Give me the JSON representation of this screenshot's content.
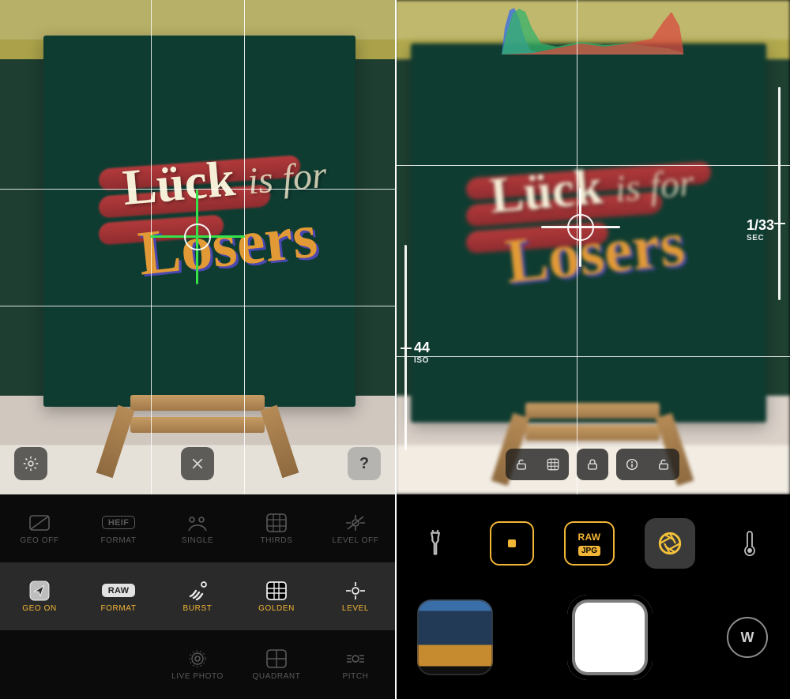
{
  "subject_text": {
    "line1_main": "Lück",
    "line1_rest": "is for",
    "line2": "Losers"
  },
  "left": {
    "overlay": {
      "settings_label": "Settings",
      "close_label": "Close",
      "help_label": "Help"
    },
    "options": {
      "row_dim_top": [
        {
          "id": "geo-off",
          "label": "GEO OFF"
        },
        {
          "id": "format-heif",
          "label": "FORMAT",
          "badge": "HEIF"
        },
        {
          "id": "mode-single",
          "label": "SINGLE"
        },
        {
          "id": "grid-thirds",
          "label": "THIRDS"
        },
        {
          "id": "level-off",
          "label": "LEVEL OFF"
        }
      ],
      "row_active": [
        {
          "id": "geo-on",
          "label": "GEO ON"
        },
        {
          "id": "format-raw",
          "label": "FORMAT",
          "badge": "RAW"
        },
        {
          "id": "mode-burst",
          "label": "BURST"
        },
        {
          "id": "grid-golden",
          "label": "GOLDEN"
        },
        {
          "id": "level-on",
          "label": "LEVEL"
        }
      ],
      "row_dim_bottom": [
        {
          "id": "spacer1",
          "label": ""
        },
        {
          "id": "spacer2",
          "label": ""
        },
        {
          "id": "live-photo",
          "label": "LIVE PHOTO"
        },
        {
          "id": "grid-quadrant",
          "label": "QUADRANT"
        },
        {
          "id": "pitch",
          "label": "PITCH"
        }
      ]
    }
  },
  "right": {
    "shutter_speed": {
      "value": "1/33",
      "unit": "SEC"
    },
    "iso": {
      "value": "44",
      "unit": "ISO"
    },
    "quick_actions": {
      "flashlight": "Flashlight",
      "focus_square": "Focus mode",
      "format_top": "RAW",
      "format_bottom": "JPG",
      "aperture": "Aperture",
      "temperature": "Temperature"
    },
    "wb_button": "W",
    "shutter": "Shutter",
    "gallery": "Last photo"
  }
}
